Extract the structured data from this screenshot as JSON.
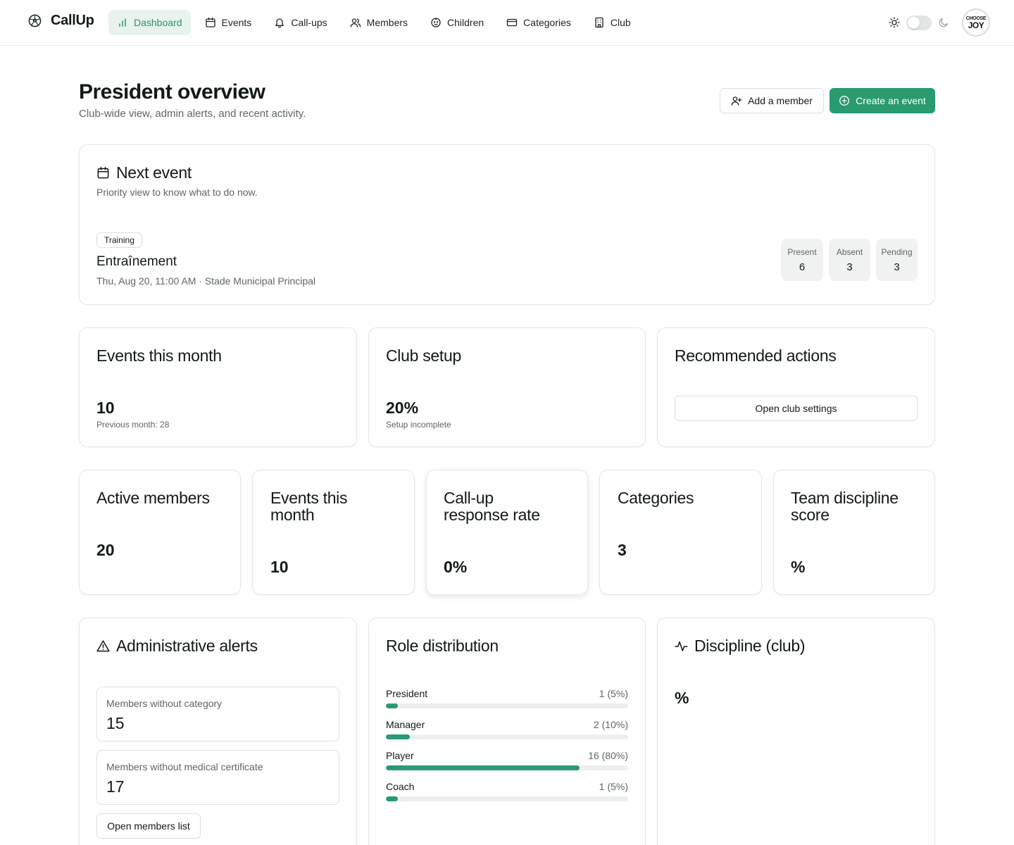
{
  "app": {
    "name": "CallUp"
  },
  "nav": {
    "items": [
      {
        "label": "Dashboard",
        "icon": "bar-chart-icon",
        "active": true
      },
      {
        "label": "Events",
        "icon": "calendar-icon",
        "active": false
      },
      {
        "label": "Call-ups",
        "icon": "bell-icon",
        "active": false
      },
      {
        "label": "Members",
        "icon": "users-icon",
        "active": false
      },
      {
        "label": "Children",
        "icon": "baby-icon",
        "active": false
      },
      {
        "label": "Categories",
        "icon": "card-icon",
        "active": false
      },
      {
        "label": "Club",
        "icon": "building-icon",
        "active": false
      }
    ],
    "theme_toggle": {
      "light_icon": "sun-icon",
      "dark_icon": "moon-icon",
      "dark": false
    },
    "avatar": {
      "line1": "CHOOSE",
      "line2": "JOY"
    }
  },
  "header": {
    "title": "President overview",
    "subtitle": "Club-wide view, admin alerts, and recent activity.",
    "add_member_label": "Add a member",
    "create_event_label": "Create an event"
  },
  "next_event": {
    "title": "Next event",
    "subtitle": "Priority view to know what to do now.",
    "badge": "Training",
    "name": "Entraînement",
    "details": "Thu, Aug 20, 11:00 AM · Stade Municipal Principal",
    "stats": [
      {
        "label": "Present",
        "value": "6"
      },
      {
        "label": "Absent",
        "value": "3"
      },
      {
        "label": "Pending",
        "value": "3"
      }
    ]
  },
  "summary": {
    "events_month": {
      "title": "Events this month",
      "value": "10",
      "note": "Previous month: 28"
    },
    "club_setup": {
      "title": "Club setup",
      "value": "20%",
      "note": "Setup incomplete"
    },
    "recommended": {
      "title": "Recommended actions",
      "button_label": "Open club settings"
    }
  },
  "kpis": [
    {
      "title": "Active members",
      "value": "20"
    },
    {
      "title": "Events this month",
      "value": "10"
    },
    {
      "title": "Call-up response rate",
      "value": "0%"
    },
    {
      "title": "Categories",
      "value": "3"
    },
    {
      "title": "Team discipline score",
      "value": "%"
    }
  ],
  "alerts": {
    "title": "Administrative alerts",
    "items": [
      {
        "label": "Members without category",
        "value": "15"
      },
      {
        "label": "Members without medical certificate",
        "value": "17"
      }
    ],
    "button_label": "Open members list"
  },
  "roles": {
    "title": "Role distribution",
    "items": [
      {
        "label": "President",
        "value": "1 (5%)",
        "percent": 5
      },
      {
        "label": "Manager",
        "value": "2 (10%)",
        "percent": 10
      },
      {
        "label": "Player",
        "value": "16 (80%)",
        "percent": 80
      },
      {
        "label": "Coach",
        "value": "1 (5%)",
        "percent": 5
      }
    ]
  },
  "discipline": {
    "title": "Discipline (club)",
    "value": "%"
  },
  "colors": {
    "accent": "#2a9a6f",
    "accent_soft": "#e7f3ec",
    "border": "#e4e7e6",
    "muted": "#5d6763"
  }
}
